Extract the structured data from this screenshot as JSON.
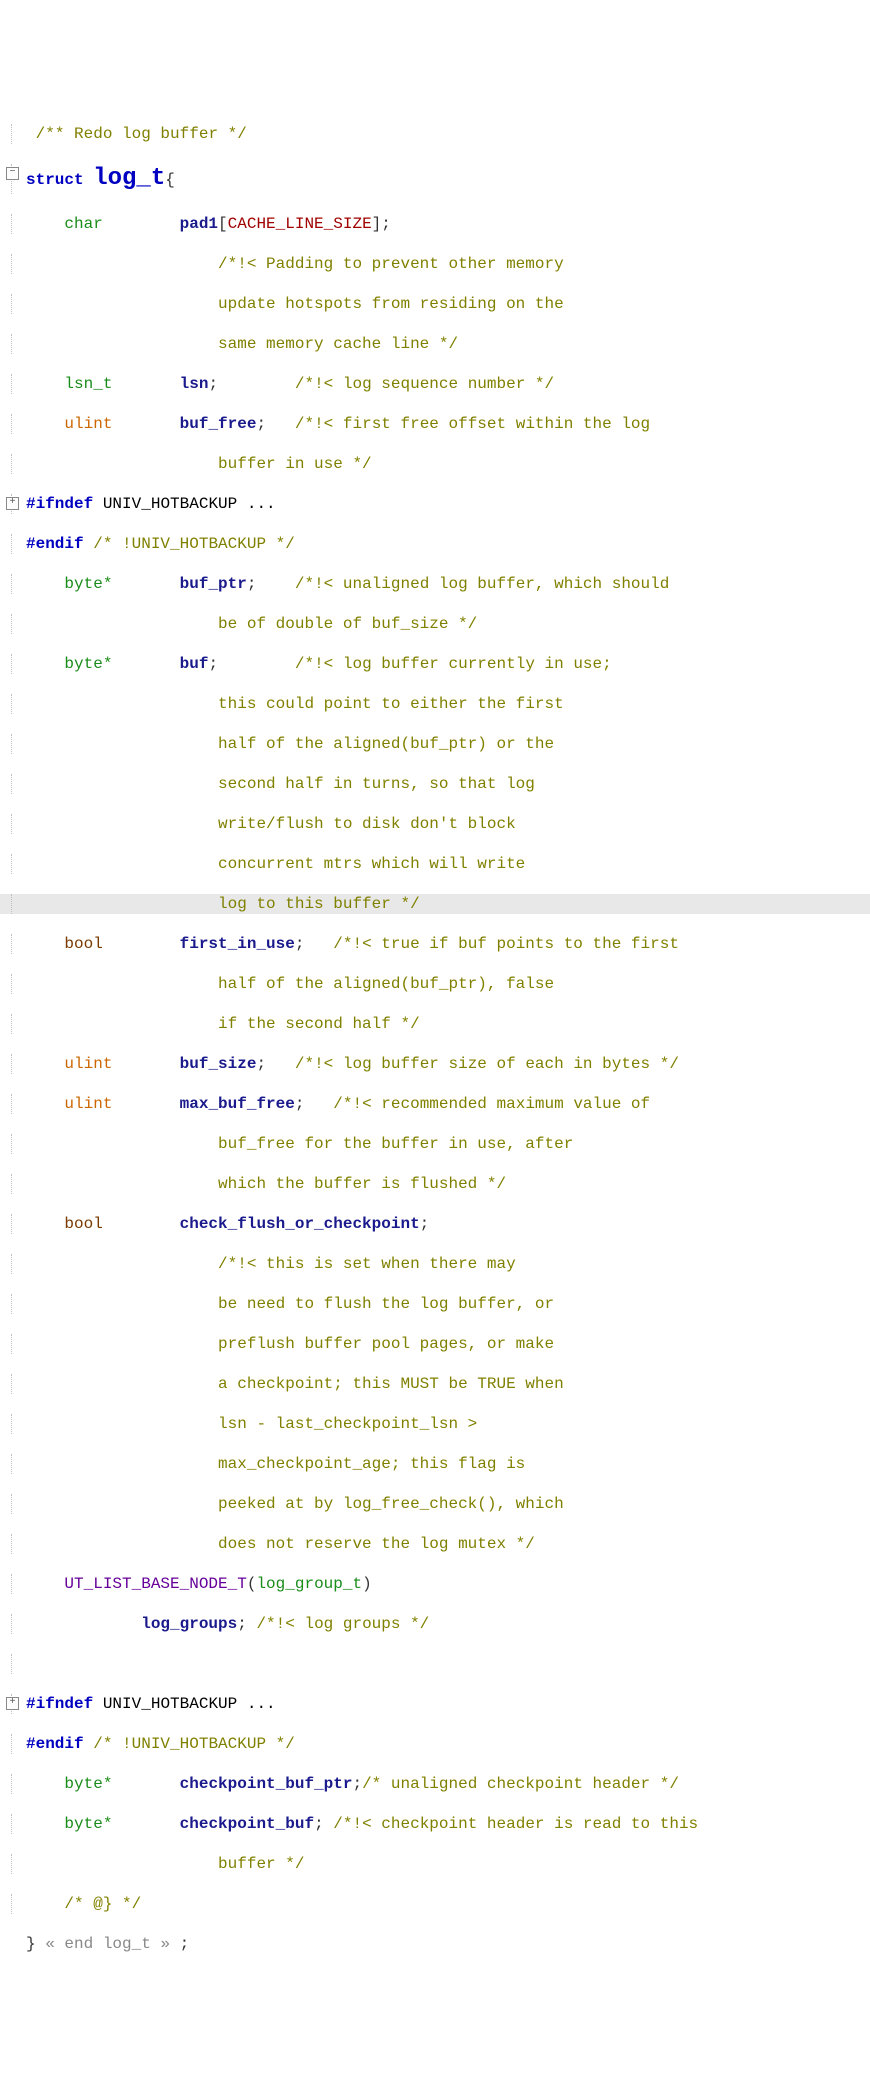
{
  "top_comment": "/** Redo log buffer */",
  "struct_kw": "struct ",
  "struct_name": "log_t",
  "struct_open": "{",
  "fields": {
    "pad1_type": "char",
    "pad1_name": "pad1",
    "pad1_open": "[",
    "pad1_macro": "CACHE_LINE_SIZE",
    "pad1_close": "];",
    "pad1_c1": "/*!< Padding to prevent other memory",
    "pad1_c2": "update hotspots from residing on the",
    "pad1_c3": "same memory cache line */",
    "lsn_type": "lsn_t",
    "lsn_name": "lsn",
    "lsn_c": "/*!< log sequence number */",
    "buf_free_type": "ulint",
    "buf_free_name": "buf_free",
    "buf_free_c1": "/*!< first free offset within the log",
    "buf_free_c2": "buffer in use */"
  },
  "ifndef1": "#ifndef",
  "ifndef1_cond": "UNIV_HOTBACKUP ...",
  "endif1": "#endif",
  "endif1_c": "/* !UNIV_HOTBACKUP */",
  "buf_ptr_type": "byte*",
  "buf_ptr_name": "buf_ptr",
  "buf_ptr_c1": "/*!< unaligned log buffer, which should",
  "buf_ptr_c2": "be of double of buf_size */",
  "buf_type": "byte*",
  "buf_name": "buf",
  "buf_c1": "/*!< log buffer currently in use;",
  "buf_c2": "this could point to either the first",
  "buf_c3": "half of the aligned(buf_ptr) or the",
  "buf_c4": "second half in turns, so that log",
  "buf_c5": "write/flush to disk don't block",
  "buf_c6": "concurrent mtrs which will write",
  "buf_c7": "log to this buffer */",
  "first_type": "bool",
  "first_name": "first_in_use",
  "first_c1": "/*!< true if buf points to the first",
  "first_c2": "half of the aligned(buf_ptr), false",
  "first_c3": "if the second half */",
  "bufsize_type": "ulint",
  "bufsize_name": "buf_size",
  "bufsize_c": "/*!< log buffer size of each in bytes */",
  "maxbuf_type": "ulint",
  "maxbuf_name": "max_buf_free",
  "maxbuf_c1": "/*!< recommended maximum value of",
  "maxbuf_c2": "buf_free for the buffer in use, after",
  "maxbuf_c3": "which the buffer is flushed */",
  "checkf_type": "bool",
  "checkf_name": "check_flush_or_checkpoint",
  "checkf_c1": "/*!< this is set when there may",
  "checkf_c2": "be need to flush the log buffer, or",
  "checkf_c3": "preflush buffer pool pages, or make",
  "checkf_c4": "a checkpoint; this MUST be TRUE when",
  "checkf_c5": "lsn - last_checkpoint_lsn >",
  "checkf_c6": "max_checkpoint_age; this flag is",
  "checkf_c7": "peeked at by log_free_check(), which",
  "checkf_c8": "does not reserve the log mutex */",
  "utlist_macro": "UT_LIST_BASE_NODE_T",
  "utlist_arg": "log_group_t",
  "log_groups_name": "log_groups",
  "log_groups_c": "/*!< log groups */",
  "ifndef2": "#ifndef",
  "ifndef2_cond": "UNIV_HOTBACKUP ...",
  "endif2": "#endif",
  "endif2_c": "/* !UNIV_HOTBACKUP */",
  "cbptr_type": "byte*",
  "cbptr_name": "checkpoint_buf_ptr",
  "cbptr_c": "/* unaligned checkpoint header */",
  "cbuf_type": "byte*",
  "cbuf_name": "checkpoint_buf",
  "cbuf_c1": "/*!< checkpoint header is read to this",
  "cbuf_c2": "buffer */",
  "end_tag": "/* @} */",
  "close_brace": "}",
  "close_annot": "« end log_t »",
  "close_semi": ";"
}
